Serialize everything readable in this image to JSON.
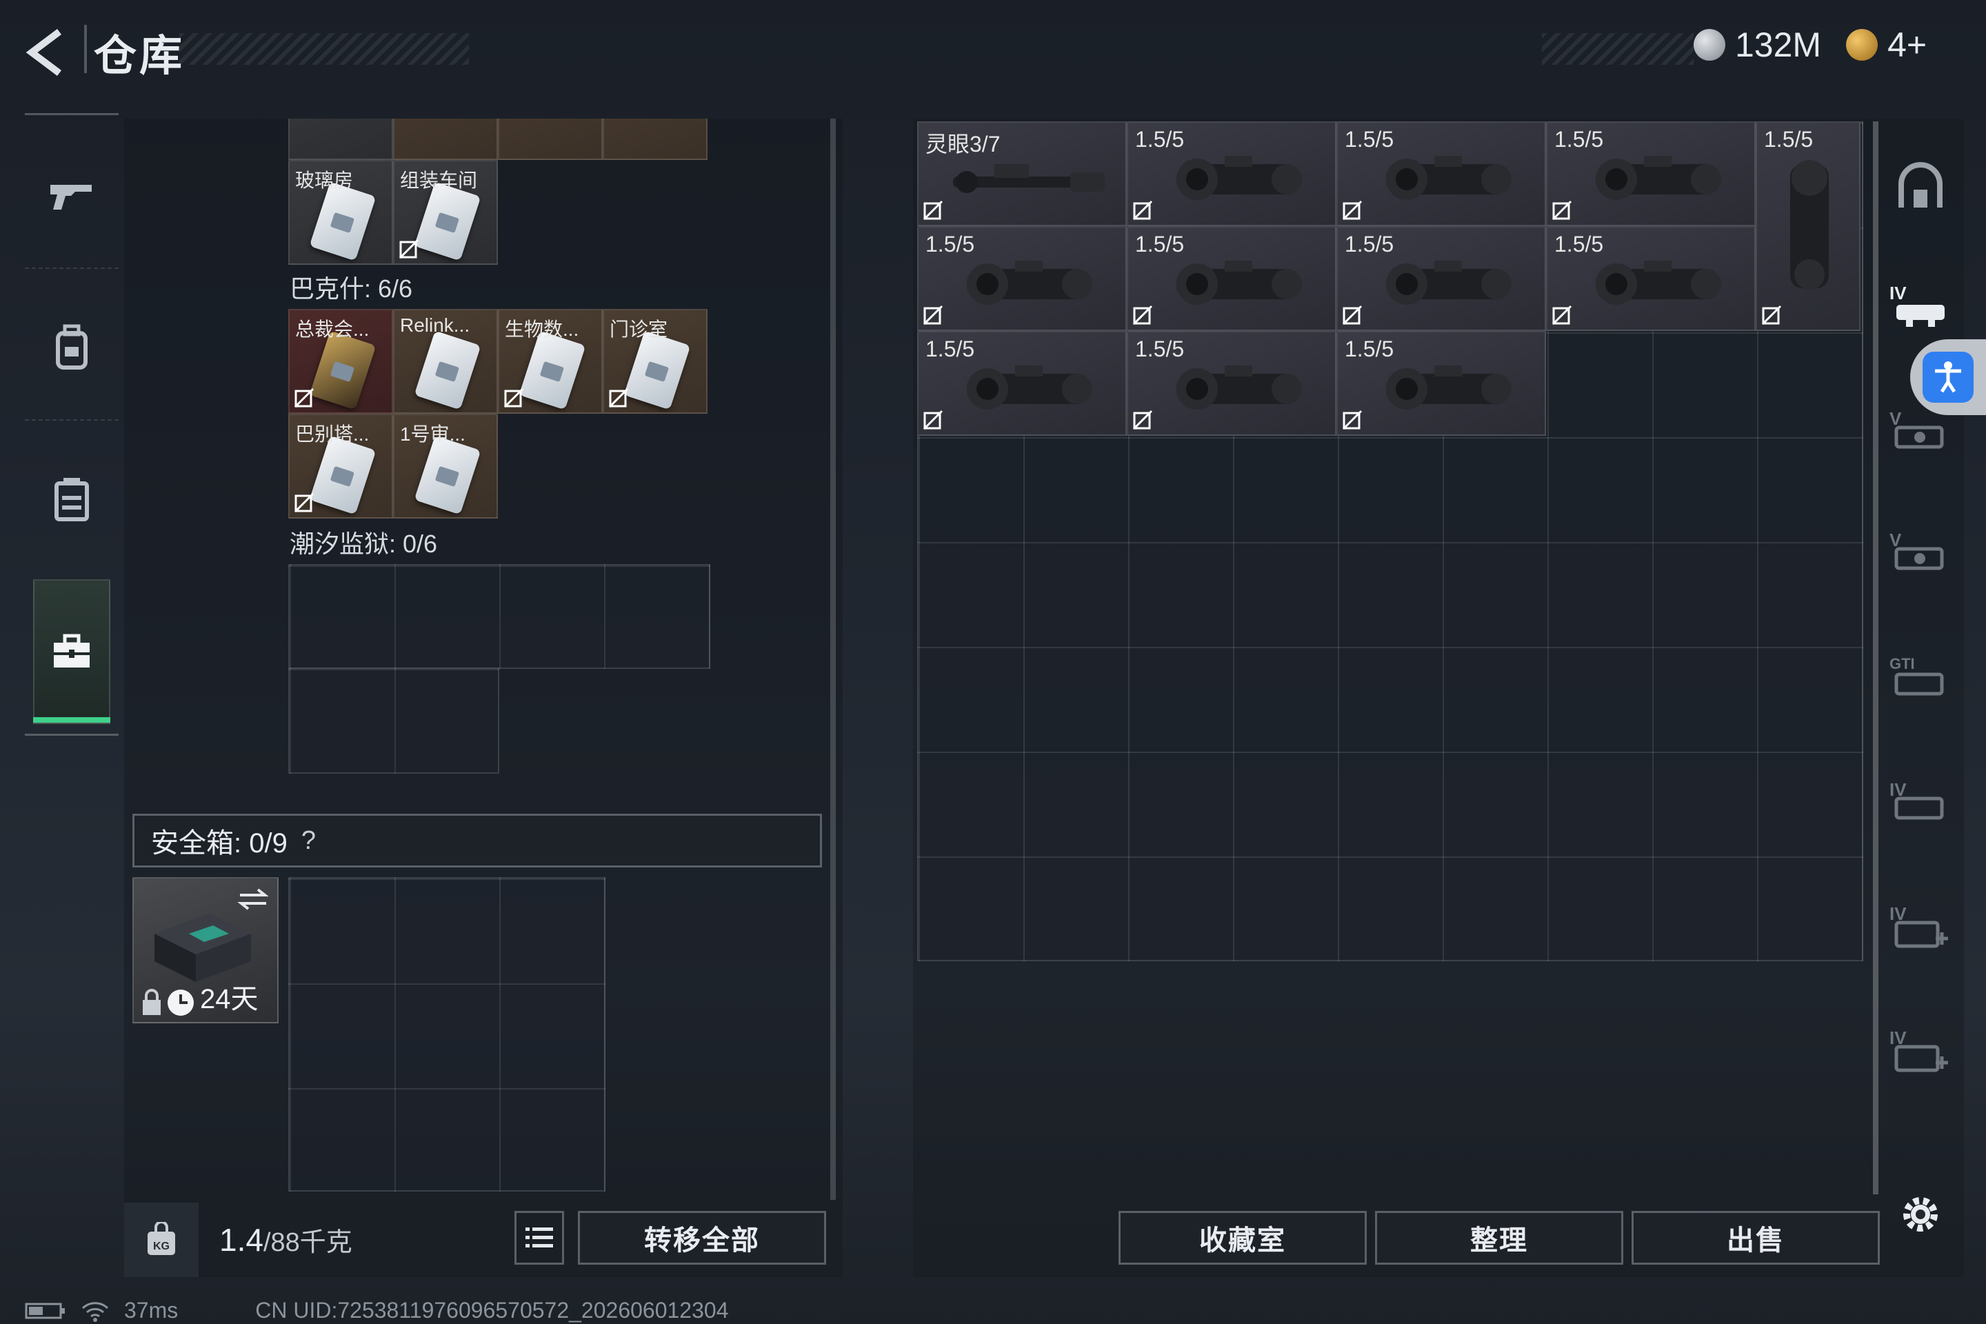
{
  "header": {
    "title": "仓库",
    "currency_amount": "132M",
    "token_amount": "4+"
  },
  "left_panel": {
    "keycard_rows_top": [
      {
        "label": "玻璃房"
      },
      {
        "label": "组装车间"
      }
    ],
    "section_bakshi": "巴克什: 6/6",
    "bakshi_cards": [
      {
        "label": "总裁会..."
      },
      {
        "label": "Relink..."
      },
      {
        "label": "生物数..."
      },
      {
        "label": "门诊室"
      },
      {
        "label": "巴别塔..."
      },
      {
        "label": "1号审..."
      }
    ],
    "section_tidal": "潮汐监狱: 0/6",
    "safebox_label": "安全箱: 0/9",
    "safebox_help": "?",
    "safebox_timer": "24天",
    "weight": "1.4",
    "weight_max": "/88千克",
    "transfer_all": "转移全部"
  },
  "right_panel": {
    "items": [
      {
        "label": "灵眼3/7"
      },
      {
        "label": "1.5/5"
      },
      {
        "label": "1.5/5"
      },
      {
        "label": "1.5/5"
      },
      {
        "label": "1.5/5"
      },
      {
        "label": "1.5/5"
      },
      {
        "label": "1.5/5"
      },
      {
        "label": "1.5/5"
      },
      {
        "label": "1.5/5"
      },
      {
        "label": "1.5/5"
      },
      {
        "label": "1.5/5"
      },
      {
        "label": "1.5/5"
      }
    ],
    "buttons": {
      "collection": "收藏室",
      "organize": "整理",
      "sell": "出售"
    }
  },
  "sidebar_right": {
    "tags": [
      "IV",
      "V",
      "V",
      "GTI",
      "IV",
      "IV",
      "IV"
    ]
  },
  "status_bar": {
    "ping": "37ms",
    "uid": "CN UID:7253811976096570572_202606012304"
  },
  "colors": {
    "accent_green": "#3fd18a",
    "accessibility_blue": "#2f7ff0"
  }
}
